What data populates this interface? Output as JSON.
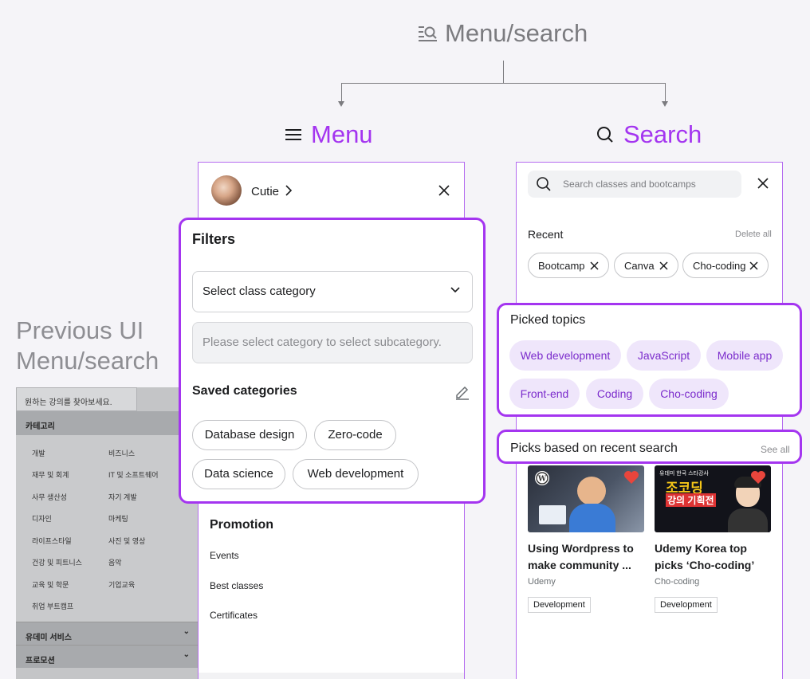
{
  "header": {
    "title": "Menu/search",
    "icon": "list-search-icon"
  },
  "menu_panel": {
    "title": "Menu",
    "icon": "hamburger-icon",
    "user_name": "Cutie",
    "filters": {
      "title": "Filters",
      "select_label": "Select class category",
      "subcategory_hint": "Please select category to select subcategory.",
      "saved_title": "Saved categories",
      "saved_chips": [
        "Database design",
        "Zero-code",
        "Data science",
        "Web development"
      ]
    },
    "promotion": {
      "title": "Promotion",
      "items": [
        "Events",
        "Best classes",
        "Certificates"
      ]
    }
  },
  "search_panel": {
    "title": "Search",
    "icon": "search-icon",
    "search_placeholder": "Search classes and bootcamps",
    "recent_title": "Recent",
    "delete_all": "Delete all",
    "recent_chips": [
      "Bootcamp",
      "Canva",
      "Cho-coding"
    ],
    "picked_title": "Picked topics",
    "picked_chips": [
      "Web development",
      "JavaScript",
      "Mobile app",
      "Front-end",
      "Coding",
      "Cho-coding"
    ],
    "picks_title": "Picks based on recent search",
    "see_all": "See all",
    "courses": [
      {
        "title": "Using Wordpress to make community ...",
        "author": "Udemy",
        "tag": "Development",
        "thumb_icon": "wordpress-icon"
      },
      {
        "title": "Udemy Korea top picks ‘Cho-coding’",
        "author": "Cho-coding",
        "tag": "Development",
        "thumb_line1": "유데미 한국 스타강사",
        "thumb_line2": "조코딩",
        "thumb_line3": "강의 기획전"
      }
    ]
  },
  "previous_ui": {
    "title_line1": "Previous UI",
    "title_line2": "Menu/search",
    "search_placeholder": "원하는 강의를 찾아보세요.",
    "category_header": "카테고리",
    "categories_left": [
      "개발",
      "재무 및 회계",
      "사무 생산성",
      "디자인",
      "라이프스타일",
      "건강 및 피트니스",
      "교육 및 학문",
      "취업 부트캠프"
    ],
    "categories_right": [
      "비즈니스",
      "IT 및 소프트웨어",
      "자기 계발",
      "마케팅",
      "사진 및 영상",
      "음악",
      "기업교육"
    ],
    "accordion": [
      "유데미 서비스",
      "프로모션"
    ]
  },
  "colors": {
    "accent": "#a435f0",
    "chip_bg": "#efe6fb",
    "chip_text": "#7b2ccc"
  }
}
